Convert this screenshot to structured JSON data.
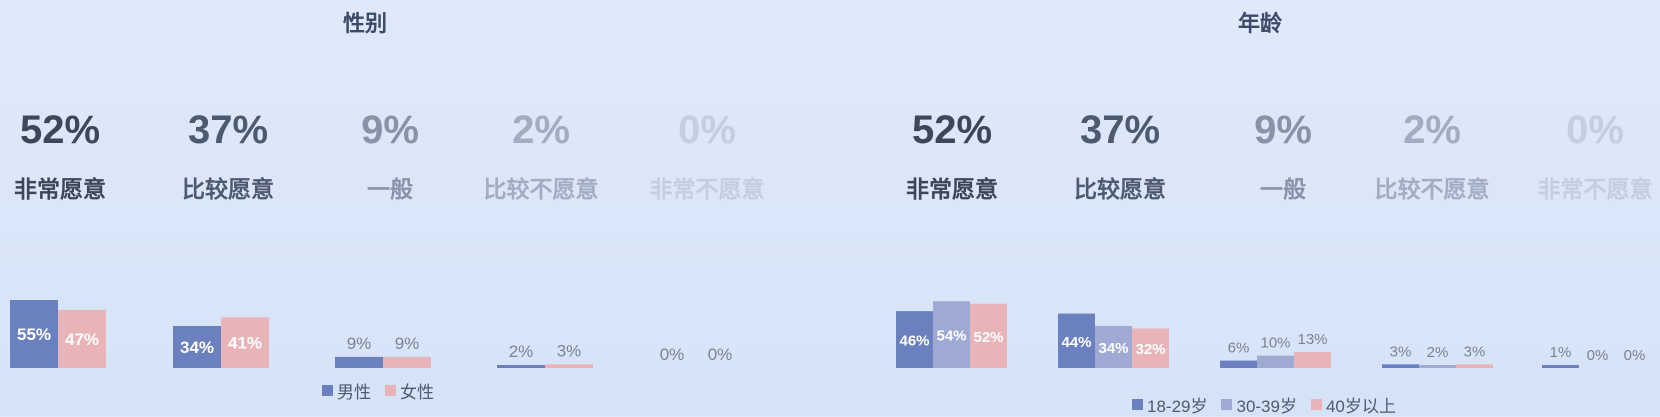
{
  "colors": {
    "male": "#6b80bf",
    "female": "#e8b4b8",
    "age_18_29": "#6b80bf",
    "age_30_39": "#9eaad4",
    "age_40_plus": "#e8b4b8"
  },
  "categories": [
    "非常愿意",
    "比较愿意",
    "一般",
    "比较不愿意",
    "非常不愿意"
  ],
  "totals": [
    "52%",
    "37%",
    "9%",
    "2%",
    "0%"
  ],
  "gender": {
    "title": "性别",
    "legend": [
      "男性",
      "女性"
    ]
  },
  "age": {
    "title": "年龄",
    "legend": [
      "18-29岁",
      "30-39岁",
      "40岁以上"
    ]
  },
  "chart_data": [
    {
      "type": "bar",
      "title": "性别",
      "categories": [
        "非常愿意",
        "比较愿意",
        "一般",
        "比较不愿意",
        "非常不愿意"
      ],
      "series": [
        {
          "name": "男性",
          "values": [
            55,
            34,
            9,
            2,
            0
          ],
          "labels": [
            "55%",
            "34%",
            "9%",
            "2%",
            "0%"
          ]
        },
        {
          "name": "女性",
          "values": [
            47,
            41,
            9,
            3,
            0
          ],
          "labels": [
            "47%",
            "41%",
            "9%",
            "3%",
            "0%"
          ]
        }
      ],
      "ylim": [
        0,
        55
      ],
      "grid": false,
      "legend_position": "bottom"
    },
    {
      "type": "bar",
      "title": "年龄",
      "categories": [
        "非常愿意",
        "比较愿意",
        "一般",
        "比较不愿意",
        "非常不愿意"
      ],
      "series": [
        {
          "name": "18-29岁",
          "values": [
            46,
            44,
            6,
            3,
            1
          ],
          "labels": [
            "46%",
            "44%",
            "6%",
            "3%",
            "1%"
          ]
        },
        {
          "name": "30-39岁",
          "values": [
            54,
            34,
            10,
            2,
            0
          ],
          "labels": [
            "54%",
            "34%",
            "10%",
            "2%",
            "0%"
          ]
        },
        {
          "name": "40岁以上",
          "values": [
            52,
            32,
            13,
            3,
            0
          ],
          "labels": [
            "52%",
            "32%",
            "13%",
            "3%",
            "0%"
          ]
        }
      ],
      "ylim": [
        0,
        55
      ],
      "grid": false,
      "legend_position": "bottom"
    }
  ]
}
